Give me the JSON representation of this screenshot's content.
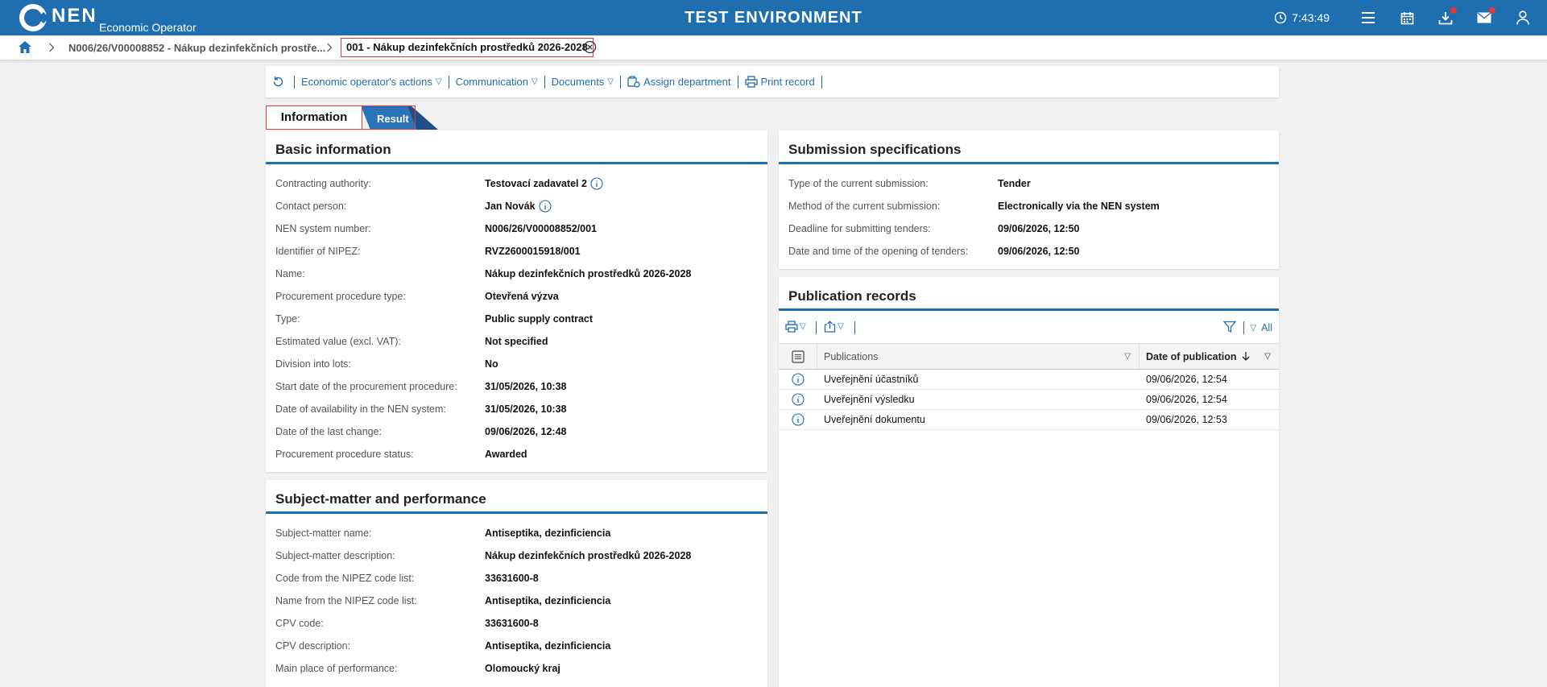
{
  "header": {
    "logo_text": "NEN",
    "logo_sub": "Economic Operator",
    "env_title": "TEST ENVIRONMENT",
    "clock": "7:43:49"
  },
  "breadcrumb": {
    "item1": "N006/26/V00008852 - Nákup dezinfekčních prostře...",
    "item2": "001 - Nákup dezinfekčních prostředků 2026-2028"
  },
  "toolbar": {
    "eo_actions": "Economic operator's actions",
    "communication": "Communication",
    "documents": "Documents",
    "assign_department": "Assign department",
    "print_record": "Print record"
  },
  "tabs": {
    "information": "Information",
    "result": "Result"
  },
  "basic": {
    "title": "Basic information",
    "rows": [
      {
        "label": "Contracting authority:",
        "value": "Testovací zadavatel 2"
      },
      {
        "label": "Contact person:",
        "value": "Jan Novák"
      },
      {
        "label": "NEN system number:",
        "value": "N006/26/V00008852/001"
      },
      {
        "label": "Identifier of NIPEZ:",
        "value": "RVZ2600015918/001"
      },
      {
        "label": "Name:",
        "value": "Nákup dezinfekčních prostředků 2026-2028"
      },
      {
        "label": "Procurement procedure type:",
        "value": "Otevřená výzva"
      },
      {
        "label": "Type:",
        "value": "Public supply contract"
      },
      {
        "label": "Estimated value (excl. VAT):",
        "value": "Not specified"
      },
      {
        "label": "Division into lots:",
        "value": "No"
      },
      {
        "label": "Start date of the procurement procedure:",
        "value": "31/05/2026, 10:38"
      },
      {
        "label": "Date of availability in the NEN system:",
        "value": "31/05/2026, 10:38"
      },
      {
        "label": "Date of the last change:",
        "value": "09/06/2026, 12:48"
      },
      {
        "label": "Procurement procedure status:",
        "value": "Awarded"
      }
    ]
  },
  "subject": {
    "title": "Subject-matter and performance",
    "rows": [
      {
        "label": "Subject-matter name:",
        "value": "Antiseptika, dezinficiencia"
      },
      {
        "label": "Subject-matter description:",
        "value": "Nákup dezinfekčních prostředků 2026-2028"
      },
      {
        "label": "Code from the NIPEZ code list:",
        "value": "33631600-8"
      },
      {
        "label": "Name from the NIPEZ code list:",
        "value": "Antiseptika, dezinficiencia"
      },
      {
        "label": "CPV code:",
        "value": "33631600-8"
      },
      {
        "label": "CPV description:",
        "value": "Antiseptika, dezinficiencia"
      },
      {
        "label": "Main place of performance:",
        "value": "Olomoucký kraj"
      }
    ]
  },
  "submission": {
    "title": "Submission specifications",
    "rows": [
      {
        "label": "Type of the current submission:",
        "value": "Tender"
      },
      {
        "label": "Method of the current submission:",
        "value": "Electronically via the NEN system"
      },
      {
        "label": "Deadline for submitting tenders:",
        "value": "09/06/2026, 12:50"
      },
      {
        "label": "Date and time of the opening of tenders:",
        "value": "09/06/2026, 12:50"
      }
    ]
  },
  "publications": {
    "title": "Publication records",
    "filter_all": "All",
    "col_publications": "Publications",
    "col_date": "Date of publication",
    "rows": [
      {
        "name": "Uveřejnění účastníků",
        "date": "09/06/2026, 12:54"
      },
      {
        "name": "Uveřejnění výsledku",
        "date": "09/06/2026, 12:54"
      },
      {
        "name": "Uveřejnění dokumentu",
        "date": "09/06/2026, 12:53"
      }
    ]
  },
  "colors": {
    "brand": "#1f6fb0",
    "highlight": "#e53935",
    "notification_dot": "#e53935"
  }
}
